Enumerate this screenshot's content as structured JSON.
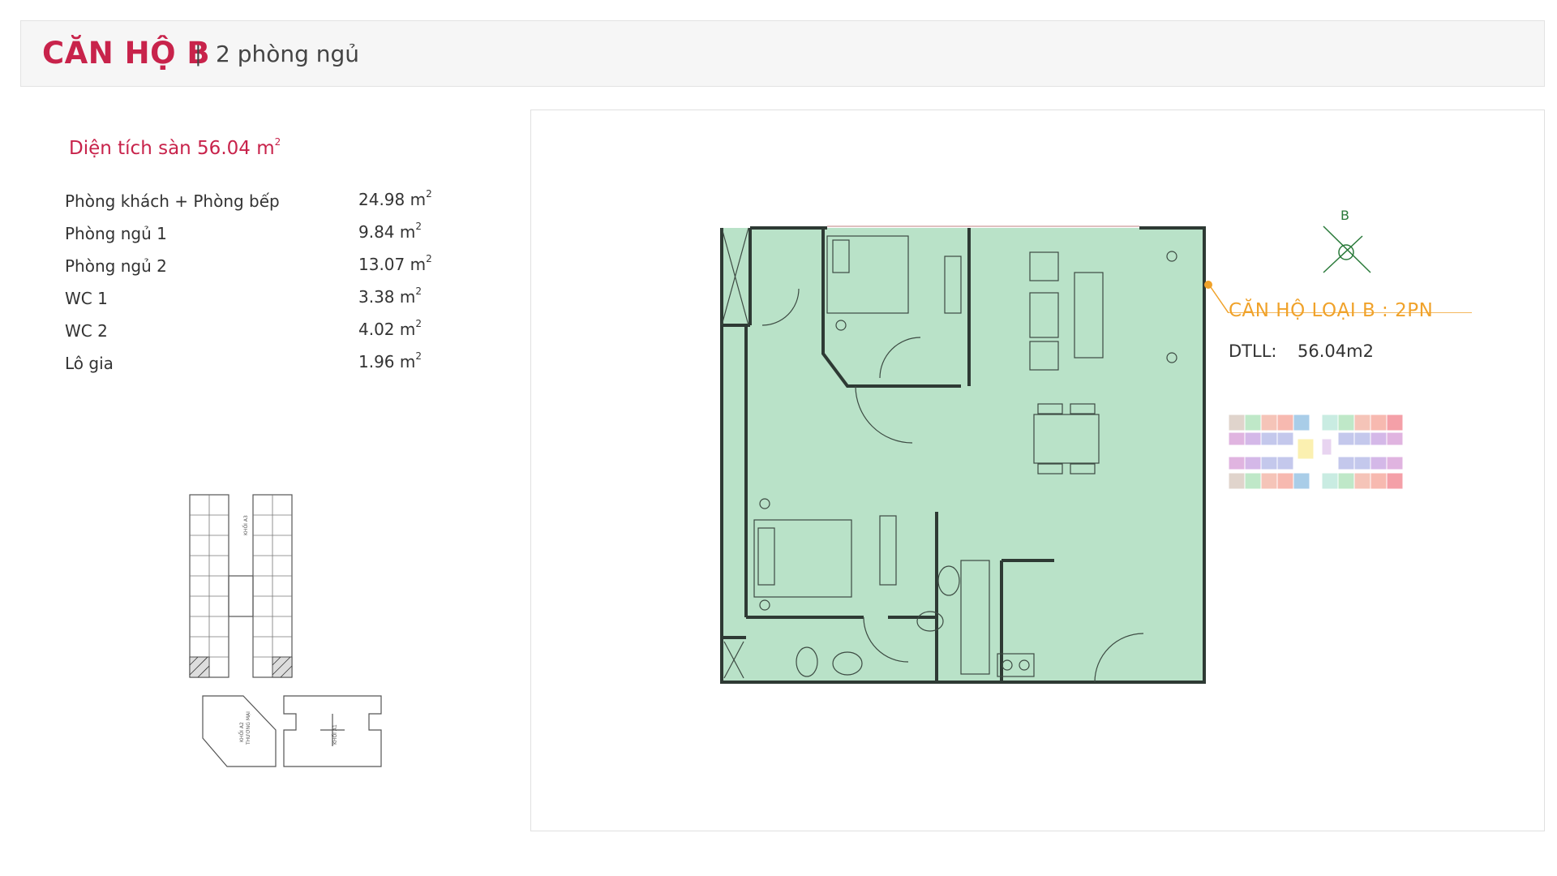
{
  "header": {
    "title": "CĂN HỘ B",
    "separator": "|",
    "subtitle": "2 phòng ngủ"
  },
  "summary": {
    "label": "Diện tích sàn 56.04 m",
    "sup": "2"
  },
  "rooms": [
    {
      "name": "Phòng khách + Phòng bếp",
      "value": "24.98 m",
      "sup": "2"
    },
    {
      "name": "Phòng ngủ 1",
      "value": "9.84 m",
      "sup": "2"
    },
    {
      "name": "Phòng ngủ 2",
      "value": "13.07 m",
      "sup": "2"
    },
    {
      "name": "WC 1",
      "value": "3.38 m",
      "sup": "2"
    },
    {
      "name": "WC 2",
      "value": "4.02 m",
      "sup": "2"
    },
    {
      "name": "Lô gia",
      "value": "1.96 m",
      "sup": "2"
    }
  ],
  "plan": {
    "compass_letter": "B",
    "type_label": "CĂN HỘ LOẠI B : 2PN",
    "dtll_label": "DTLL:",
    "dtll_value": "56.04m2"
  },
  "keyplan": {
    "block_a3": "KHỐI A3",
    "block_a2": "KHỐI A2",
    "block_a2_sub": "THƯƠNG MẠI",
    "block_a1": "KHỐI A1"
  },
  "colors": {
    "accent": "#c8234b",
    "floor_green": "#b9e2c8",
    "wall": "#2e3a34",
    "label_orange": "#f0a22a"
  }
}
